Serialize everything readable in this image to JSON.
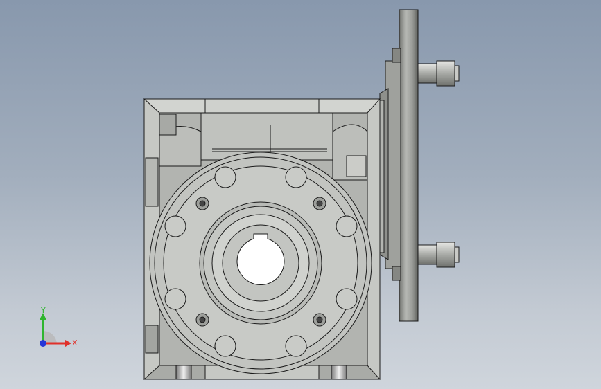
{
  "viewport": {
    "background_top": "#8898ad",
    "background_bottom": "#cfd5dc"
  },
  "model": {
    "part_color": "#c4c6c2",
    "part_dark": "#8e908c",
    "edge_color": "#1a1a1a"
  },
  "triad": {
    "x_label": "X",
    "y_label": "Y",
    "x_color": "#e0302a",
    "y_color": "#2fb52f",
    "z_color": "#2636d8"
  }
}
